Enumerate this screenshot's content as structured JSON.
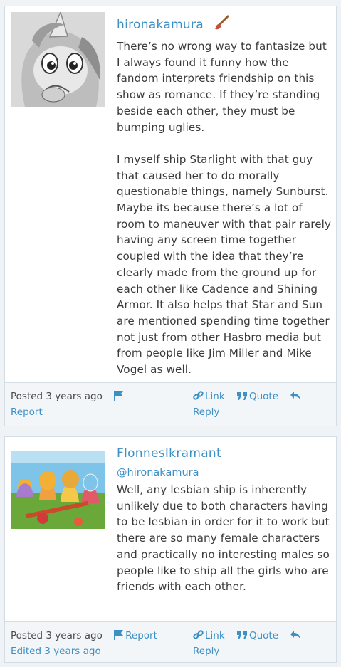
{
  "comments": [
    {
      "author": "hironakamura",
      "author_badge_icon": "paintbrush-icon",
      "paragraphs": [
        "There’s no wrong way to fantasize but I always found it funny how the fandom interprets friendship on this show as romance. If they’re standing beside each other, they must be bumping uglies.",
        "I myself ship Starlight with that guy that caused her to do morally questionable things, namely Sunburst. Maybe its because there’s a lot of room to maneuver with that pair rarely having any screen time together coupled with the idea that they’re clearly made from the ground up for each other like Cadence and Shining Armor. It also helps that Star and Sun are mentioned spending time together not just from other Hasbro media but from people like Jim Miller and Mike Vogel as well."
      ],
      "posted": "Posted 3 years ago",
      "report": "Report",
      "link": "Link",
      "quote": "Quote",
      "reply": "Reply"
    },
    {
      "author": "FlonnesIkramant",
      "mention": "@hironakamura",
      "paragraphs": [
        "Well, any lesbian ship is inherently unlikely due to both characters having to be lesbian in order for it to work but there are so many female characters and practically no interesting males so people like to ship all the girls who are friends with each other."
      ],
      "posted": "Posted 3 years ago",
      "report": "Report",
      "edited": "Edited 3 years ago",
      "link": "Link",
      "quote": "Quote",
      "reply": "Reply"
    }
  ],
  "colors": {
    "link": "#3d8fc4",
    "text": "#3a3a3a",
    "border": "#d4dde6"
  }
}
